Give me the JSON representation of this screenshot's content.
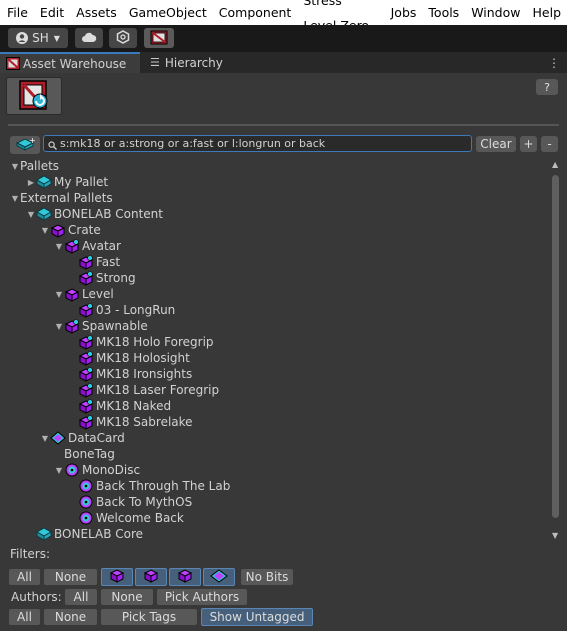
{
  "menu": [
    "File",
    "Edit",
    "Assets",
    "GameObject",
    "Component",
    "Stress Level Zero",
    "Jobs",
    "Tools",
    "Window",
    "Help"
  ],
  "toolbar": {
    "account_label": "SH"
  },
  "tabs": [
    {
      "label": "Asset Warehouse",
      "icon": "crate-icon"
    },
    {
      "label": "Hierarchy",
      "icon": "list-icon"
    }
  ],
  "help_label": "?",
  "search": {
    "value": "s:mk18 or a:strong or a:fast or l:longrun or back",
    "clear_label": "Clear",
    "plus_label": "+",
    "minus_label": "-"
  },
  "tree": [
    {
      "label": "Pallets",
      "icon": "none"
    },
    {
      "label": "My Pallet",
      "icon": "pallet"
    },
    {
      "label": "External Pallets",
      "icon": "none"
    },
    {
      "label": "BONELAB Content",
      "icon": "pallet"
    },
    {
      "label": "Crate",
      "icon": "crate"
    },
    {
      "label": "Avatar",
      "icon": "crate-avatar"
    },
    {
      "label": "Fast",
      "icon": "crate-avatar"
    },
    {
      "label": "Strong",
      "icon": "crate-avatar"
    },
    {
      "label": "Level",
      "icon": "crate"
    },
    {
      "label": "03 - LongRun",
      "icon": "crate-level"
    },
    {
      "label": "Spawnable",
      "icon": "crate-avatar"
    },
    {
      "label": "MK18 Holo Foregrip",
      "icon": "crate-spawn"
    },
    {
      "label": "MK18 Holosight",
      "icon": "crate-spawn"
    },
    {
      "label": "MK18 Ironsights",
      "icon": "crate-spawn"
    },
    {
      "label": "MK18 Laser Foregrip",
      "icon": "crate-spawn"
    },
    {
      "label": "MK18 Naked",
      "icon": "crate-spawn"
    },
    {
      "label": "MK18 Sabrelake",
      "icon": "crate-spawn"
    },
    {
      "label": "DataCard",
      "icon": "datacard"
    },
    {
      "label": "BoneTag",
      "icon": "none"
    },
    {
      "label": "MonoDisc",
      "icon": "monodisc"
    },
    {
      "label": "Back Through The Lab",
      "icon": "monodisc"
    },
    {
      "label": "Back To MythOS",
      "icon": "monodisc"
    },
    {
      "label": "Welcome Back",
      "icon": "monodisc"
    },
    {
      "label": "BONELAB Core",
      "icon": "pallet"
    }
  ],
  "filters": {
    "title": "Filters:",
    "all_label": "All",
    "none_label": "None",
    "no_bits_label": "No Bits",
    "type_icons": [
      "crate-avatar-icon",
      "crate-level-icon",
      "crate-spawnable-icon",
      "datacard-icon"
    ],
    "authors_label": "Authors:",
    "pick_authors_label": "Pick Authors",
    "pick_tags_label": "Pick Tags",
    "show_untagged_label": "Show Untagged"
  },
  "colors": {
    "accent": "#3a79bb",
    "crate": "#a020f0",
    "pallet": "#33c8d8",
    "selected_toggle": "#46607c"
  }
}
